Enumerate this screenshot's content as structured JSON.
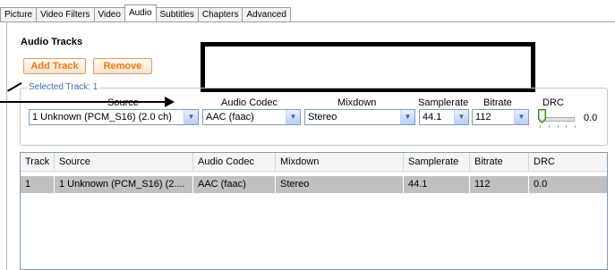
{
  "tabs": [
    {
      "label": "Picture"
    },
    {
      "label": "Video Filters"
    },
    {
      "label": "Video"
    },
    {
      "label": "Audio",
      "active": true
    },
    {
      "label": "Subtitles"
    },
    {
      "label": "Chapters"
    },
    {
      "label": "Advanced"
    }
  ],
  "section": {
    "title": "Audio Tracks",
    "add_label": "Add Track",
    "remove_label": "Remove"
  },
  "selected_track": {
    "legend": "Selected Track: 1",
    "headers": {
      "source": "Source",
      "codec": "Audio Codec",
      "mixdown": "Mixdown",
      "samplerate": "Samplerate",
      "bitrate": "Bitrate",
      "drc": "DRC"
    },
    "values": {
      "source": "1 Unknown (PCM_S16) (2.0 ch)",
      "codec": "AAC (faac)",
      "mixdown": "Stereo",
      "samplerate": "44.1",
      "bitrate": "112",
      "drc": "0.0"
    },
    "drc_level": 0
  },
  "table": {
    "columns": [
      "Track",
      "Source",
      "Audio Codec",
      "Mixdown",
      "Samplerate",
      "Bitrate",
      "DRC"
    ],
    "rows": [
      [
        "1",
        "1 Unknown (PCM_S16) (2....",
        "AAC (faac)",
        "Stereo",
        "44.1",
        "112",
        "0.0"
      ]
    ]
  },
  "colors": {
    "button_text": "#f07810",
    "legend_text": "#3a6fb0",
    "selected_row": "#c0c0c0"
  }
}
